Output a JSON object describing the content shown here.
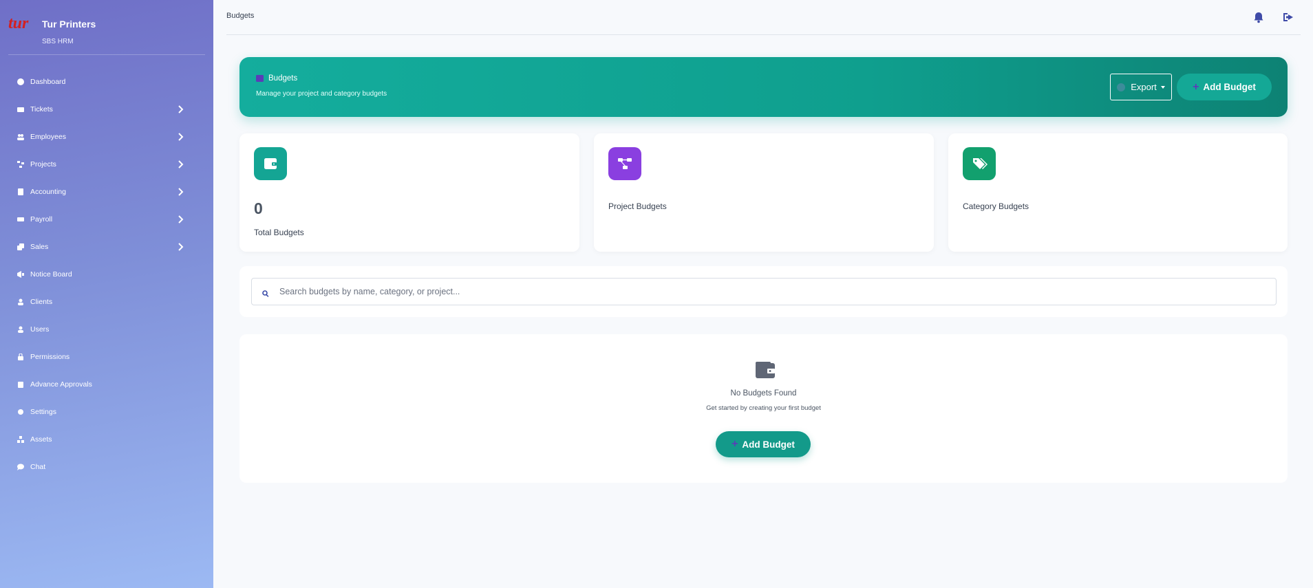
{
  "sidebar": {
    "brand_name": "Tur Printers",
    "brand_sub": "SBS HRM",
    "items": [
      {
        "label": "Dashboard",
        "icon": "dashboard-icon"
      },
      {
        "label": "Tickets",
        "icon": "ticket-icon"
      },
      {
        "label": "Employees",
        "icon": "employees-icon"
      },
      {
        "label": "Projects",
        "icon": "projects-icon"
      },
      {
        "label": "Accounting",
        "icon": "accounting-icon"
      },
      {
        "label": "Payroll",
        "icon": "payroll-icon"
      },
      {
        "label": "Sales",
        "icon": "sales-icon"
      },
      {
        "label": "Notice Board",
        "icon": "megaphone-icon"
      },
      {
        "label": "Clients",
        "icon": "user-icon"
      },
      {
        "label": "Users",
        "icon": "user-icon"
      },
      {
        "label": "Permissions",
        "icon": "lock-icon"
      },
      {
        "label": "Advance Approvals",
        "icon": "clipboard-icon"
      },
      {
        "label": "Settings",
        "icon": "gear-icon"
      },
      {
        "label": "Assets",
        "icon": "assets-icon"
      },
      {
        "label": "Chat",
        "icon": "chat-icon"
      }
    ]
  },
  "topbar": {
    "breadcrumb": "Budgets"
  },
  "hero": {
    "title": "Budgets",
    "subtitle": "Manage your project and category budgets",
    "export_label": "Export",
    "add_label": "Add Budget"
  },
  "stats": {
    "total_value": "0",
    "total_label": "Total Budgets",
    "project_label": "Project Budgets",
    "category_label": "Category Budgets"
  },
  "search": {
    "placeholder": "Search budgets by name, category, or project..."
  },
  "empty": {
    "title": "No Budgets Found",
    "subtitle": "Get started by creating your first budget",
    "add_label": "Add Budget"
  },
  "colors": {
    "accent": "#14ad9d",
    "sidebar_top": "#6f6fc7",
    "sidebar_bottom": "#9cb9f3",
    "project_icon": "#8a3fe0",
    "category_icon": "#12a06e",
    "brand_logo": "#d42020"
  }
}
